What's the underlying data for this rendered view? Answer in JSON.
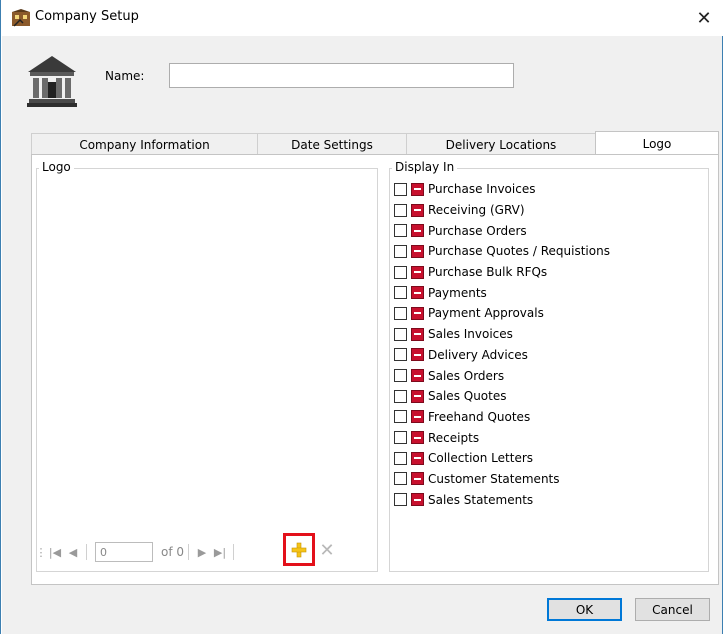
{
  "window": {
    "title": "Company Setup",
    "close_label": "✕"
  },
  "form": {
    "name_label": "Name:",
    "name_value": ""
  },
  "tabs": [
    {
      "label": "Company Information",
      "active": false
    },
    {
      "label": "Date Settings",
      "active": false
    },
    {
      "label": "Delivery Locations",
      "active": false
    },
    {
      "label": "Logo",
      "active": true
    }
  ],
  "logo_group": {
    "title": "Logo"
  },
  "navigator": {
    "position": "0",
    "of_text": "of 0"
  },
  "display_in": {
    "title": "Display In",
    "items": [
      {
        "label": "Purchase Invoices",
        "checked": false
      },
      {
        "label": "Receiving (GRV)",
        "checked": false
      },
      {
        "label": "Purchase Orders",
        "checked": false
      },
      {
        "label": "Purchase Quotes / Requistions",
        "checked": false
      },
      {
        "label": "Purchase Bulk RFQs",
        "checked": false
      },
      {
        "label": "Payments",
        "checked": false
      },
      {
        "label": "Payment Approvals",
        "checked": false
      },
      {
        "label": "Sales Invoices",
        "checked": false
      },
      {
        "label": "Delivery Advices",
        "checked": false
      },
      {
        "label": "Sales Orders",
        "checked": false
      },
      {
        "label": "Sales Quotes",
        "checked": false
      },
      {
        "label": "Freehand Quotes",
        "checked": false
      },
      {
        "label": "Receipts",
        "checked": false
      },
      {
        "label": "Collection Letters",
        "checked": false
      },
      {
        "label": "Customer Statements",
        "checked": false
      },
      {
        "label": "Sales Statements",
        "checked": false
      }
    ]
  },
  "buttons": {
    "ok": "OK",
    "cancel": "Cancel"
  },
  "colors": {
    "highlight": "#e3101a",
    "minus_red": "#c8102e",
    "accent": "#0078d7"
  }
}
